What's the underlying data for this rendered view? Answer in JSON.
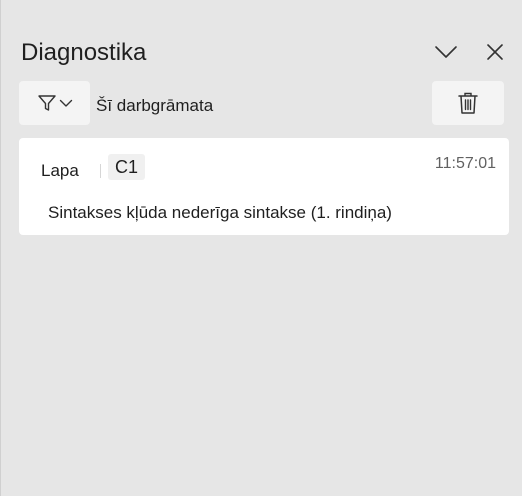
{
  "pane": {
    "title": "Diagnostika",
    "collapse_icon": "chevron-down-icon",
    "close_icon": "close-icon"
  },
  "toolbar": {
    "filter_icon": "filter-icon",
    "filter_dropdown_icon": "chevron-down-icon",
    "scope_label": "Šī darbgrāmata",
    "delete_icon": "trash-icon"
  },
  "diagnostics": [
    {
      "sheet": "Lapa",
      "cell": "C1",
      "time": "11:57:01",
      "message": "Sintakses kļūda nederīga sintakse (1. rindiņa)"
    }
  ],
  "colors": {
    "background": "#e6e6e6",
    "card": "#ffffff",
    "button": "#f4f4f4",
    "text": "#1f1f1f",
    "muted_text": "#616161"
  }
}
